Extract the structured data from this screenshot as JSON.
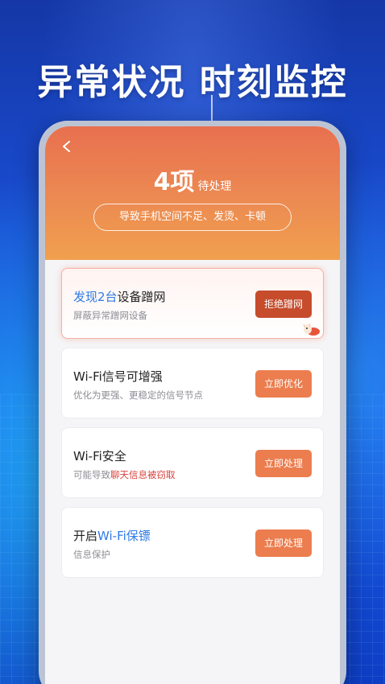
{
  "headline": "异常状况 时刻监控",
  "header": {
    "count": "4项",
    "count_label": "待处理",
    "reason": "导致手机空间不足、发烫、卡顿"
  },
  "cards": [
    {
      "title_highlight": "发现2台",
      "title_rest": "设备蹭网",
      "subtitle": "屏蔽异常蹭网设备",
      "button": "拒绝蹭网"
    },
    {
      "title": "Wi-Fi信号可增强",
      "subtitle": "优化为更强、更稳定的信号节点",
      "button": "立即优化"
    },
    {
      "title": "Wi-Fi安全",
      "subtitle_prefix": "可能导致",
      "subtitle_highlight": "聊天信息被窃取",
      "button": "立即处理"
    },
    {
      "title_prefix": "开启",
      "title_highlight": "Wi-Fi保镖",
      "subtitle": "信息保护",
      "button": "立即处理"
    }
  ],
  "colors": {
    "accent": "#ec7d4e",
    "accent_dark": "#c64c2c",
    "highlight_blue": "#2f7be6",
    "highlight_red": "#d8423b"
  },
  "icons": [
    "back-icon",
    "mascot-decoration-icon"
  ]
}
